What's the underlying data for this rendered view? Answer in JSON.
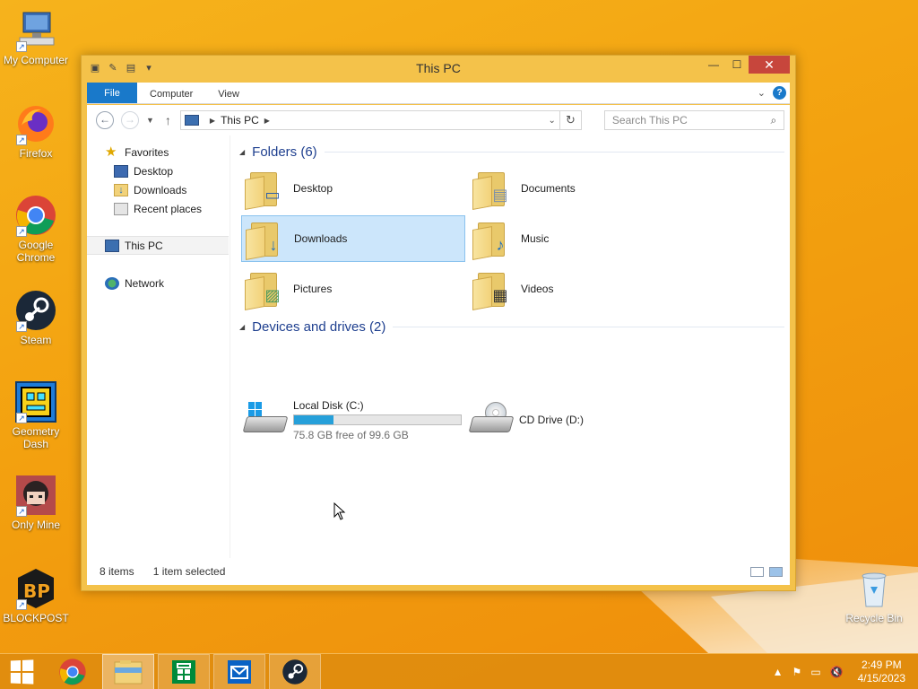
{
  "desktop": {
    "icons": [
      {
        "label": "My Computer"
      },
      {
        "label": "Firefox"
      },
      {
        "label": "Google Chrome"
      },
      {
        "label": "Steam"
      },
      {
        "label": "Geometry Dash"
      },
      {
        "label": "Only Mine"
      },
      {
        "label": "BLOCKPOST"
      },
      {
        "label": "Recycle Bin"
      }
    ]
  },
  "window": {
    "title": "This PC",
    "controls": {
      "minimize": "—",
      "maximize": "☐",
      "close": "✕"
    },
    "ribbon": {
      "file_tab": "File",
      "tabs": [
        "Computer",
        "View"
      ]
    },
    "address": {
      "path": "This PC"
    },
    "search": {
      "placeholder": "Search This PC"
    },
    "nav": {
      "favorites": "Favorites",
      "desktop": "Desktop",
      "downloads": "Downloads",
      "recent": "Recent places",
      "this_pc": "This PC",
      "network": "Network"
    },
    "folders_group": "Folders (6)",
    "folders": [
      {
        "name": "Desktop"
      },
      {
        "name": "Documents"
      },
      {
        "name": "Downloads"
      },
      {
        "name": "Music"
      },
      {
        "name": "Pictures"
      },
      {
        "name": "Videos"
      }
    ],
    "devices_group": "Devices and drives (2)",
    "drives": {
      "local": {
        "name": "Local Disk (C:)",
        "free": "75.8 GB free of 99.6 GB",
        "used_fraction": 0.239
      },
      "cd": {
        "name": "CD Drive (D:)"
      }
    },
    "status": {
      "items": "8 items",
      "selected": "1 item selected"
    }
  },
  "taskbar": {
    "time": "2:49 PM",
    "date": "4/15/2023"
  },
  "colors": {
    "accent": "#1979ca",
    "selection": "#cce6fb",
    "wallpaper": "#f3a10f",
    "close": "#c7463c"
  }
}
